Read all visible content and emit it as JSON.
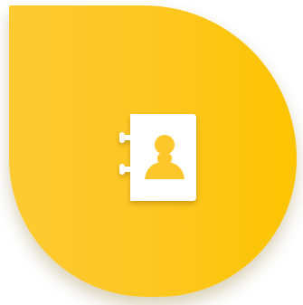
{
  "graphic": {
    "shape": "teardrop",
    "icon": "contact-book-icon",
    "colors": {
      "gradient_start": "#fdca32",
      "gradient_end": "#fcc400",
      "icon_fill": "#ffffff"
    }
  }
}
